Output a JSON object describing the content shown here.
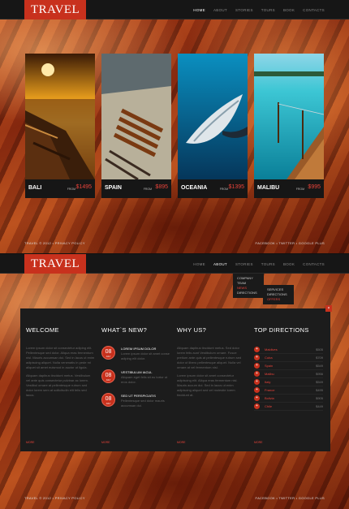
{
  "brand": {
    "logo": "TRAVEL"
  },
  "nav": [
    "HOME",
    "ABOUT",
    "STORIES",
    "TOURS",
    "BOOK",
    "CONTACTS"
  ],
  "screen1": {
    "active_nav": "HOME",
    "destinations": [
      {
        "name": "BALI",
        "from_label": "FROM",
        "price": "$1495"
      },
      {
        "name": "SPAIN",
        "from_label": "FROM",
        "price": "$895"
      },
      {
        "name": "OCEANIA",
        "from_label": "FROM",
        "price": "$1395"
      },
      {
        "name": "MALIBU",
        "from_label": "FROM",
        "price": "$995"
      }
    ]
  },
  "footer": {
    "left": "TRAVEL © 2012 • PRIVACY POLICY",
    "right": "FACEBOOK • TWITTER • GOOGLE PLUS"
  },
  "screen2": {
    "active_nav": "ABOUT",
    "about_menu": [
      "COMPANY",
      "TEAM",
      "NEWS",
      "DIRECTIONS"
    ],
    "about_menu_highlight": "NEWS",
    "sub_menu": [
      "SERVICES",
      "DIRECTIONS",
      "OFFERS"
    ],
    "sub_menu_highlight": "OFFERS",
    "close_glyph": "×",
    "welcome": {
      "title": "WELCOME",
      "paragraphs": [
        "Lorem ipsum dolor sit consectetur adiping elit. Pellentesque sed dolor. Aliqua eras fermentum nisl. Mauris accumsan dui. Sed in lacus ut enim adipiscing aliquet. Nulla venenatis in pede mi aliquet sit amet euismod in auctor ut ligula.",
        "Aliquam dapibus tincidunt metus. Vestibulum vel ante quis consectetur pulvinar ac lorem. Vestibul ornare at pellentesque rutrum sed dolor lorem sem at sollicitudin elit felis sed lacus."
      ],
      "more": "MORE"
    },
    "news": {
      "title": "WHAT`S NEW?",
      "items": [
        {
          "day": "08",
          "month": "JULY",
          "title": "LOREM IPSUM DOLOR",
          "body": "Lorem ipsum dolor sit amet conse adiping elit dolor."
        },
        {
          "day": "08",
          "month": "JULY",
          "title": "VESTIBULUM IACUL",
          "body": "Aliquam eget felis sit eu tortor ut eros dolor."
        },
        {
          "day": "08",
          "month": "JULY",
          "title": "SED UT PERSPICIATIS",
          "body": "Pellentesque sed dolor mauris accumsan dui."
        }
      ],
      "more": "MORE"
    },
    "why": {
      "title": "WHY US?",
      "paragraphs": [
        "Aliquam dapibus tincidunt metus. Sed dolor lorem felis aunt Vestibulum ornare. Fusce pretium ante quis at pellentesque rutrum sed dolor ut libero pellentesque aliquet. Nulla vel ornare at vel fermentum nisl.",
        "Lorem ipsum dolor sit amet consectetur adipiscing elit. Aliqua eras fermentum nisl. Mauris accum dui. Sed in lacus ut enim adipiscing aliquet sed vel molestie lorem tincidunt at."
      ],
      "more": "MORE"
    },
    "directions": {
      "title": "TOP DIRECTIONS",
      "bullet": "+",
      "items": [
        {
          "name": "Maldives",
          "price": "$505"
        },
        {
          "name": "Cuba",
          "price": "$709"
        },
        {
          "name": "Spain",
          "price": "$549"
        },
        {
          "name": "Malibu",
          "price": "$956"
        },
        {
          "name": "Italy",
          "price": "$549"
        },
        {
          "name": "France",
          "price": "$495"
        },
        {
          "name": "Bolivia",
          "price": "$905"
        },
        {
          "name": "Chile",
          "price": "$449"
        }
      ],
      "more": "MORE"
    }
  },
  "colors": {
    "accent": "#c8311d",
    "accent_light": "#e8433a",
    "bar": "#161616"
  }
}
